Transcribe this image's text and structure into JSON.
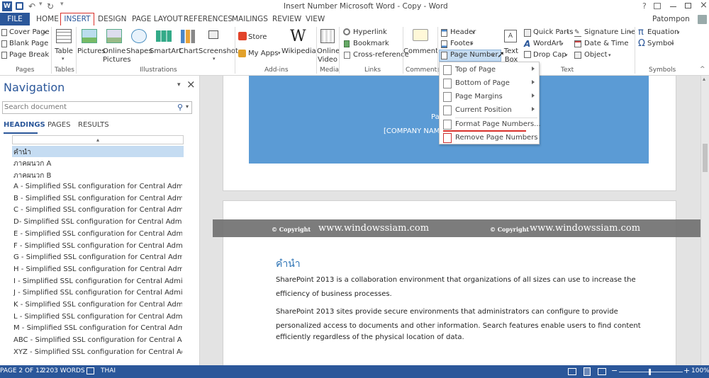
{
  "window": {
    "title": "Insert Number Microsoft Word - Copy - Word",
    "help": "?",
    "user": "Patompon"
  },
  "ribbon": {
    "tabs": [
      "FILE",
      "HOME",
      "INSERT",
      "DESIGN",
      "PAGE LAYOUT",
      "REFERENCES",
      "MAILINGS",
      "REVIEW",
      "VIEW"
    ],
    "active_tab": "INSERT",
    "pages": {
      "items": [
        "Cover Page",
        "Blank Page",
        "Page Break"
      ],
      "label": "Pages"
    },
    "tables": {
      "table": "Table",
      "label": "Tables"
    },
    "illustrations": {
      "pictures": "Pictures",
      "online_pictures": "Online Pictures",
      "shapes": "Shapes",
      "smartart": "SmartArt",
      "chart": "Chart",
      "screenshot": "Screenshot",
      "label": "Illustrations"
    },
    "addins": {
      "store": "Store",
      "my_apps": "My Apps",
      "wikipedia": "Wikipedia",
      "label": "Add-ins"
    },
    "media": {
      "online_video": "Online Video",
      "label": "Media"
    },
    "links": {
      "items": [
        "Hyperlink",
        "Bookmark",
        "Cross-reference"
      ],
      "label": "Links"
    },
    "comments": {
      "comment": "Comment",
      "label": "Comments"
    },
    "header_footer": {
      "header": "Header",
      "footer": "Footer",
      "page_number": "Page Number"
    },
    "text": {
      "text_box": "Text Box",
      "quick_parts": "Quick Parts",
      "wordart": "WordArt",
      "drop_cap": "Drop Cap",
      "signature_line": "Signature Line",
      "date_time": "Date & Time",
      "object": "Object",
      "label": "Text"
    },
    "symbols": {
      "equation": "Equation",
      "symbol": "Symbol",
      "label": "Symbols"
    }
  },
  "page_number_menu": {
    "items": [
      "Top of Page",
      "Bottom of Page",
      "Page Margins",
      "Current Position",
      "Format Page Numbers...",
      "Remove Page Numbers"
    ]
  },
  "navigation": {
    "title": "Navigation",
    "search_placeholder": "Search document",
    "tabs": [
      "HEADINGS",
      "PAGES",
      "RESULTS"
    ],
    "headings": [
      "คำนำ",
      "ภาคผนวก A",
      "ภาคผนวก B",
      "A - Simplified SSL configuration for Central Administrati...",
      "B - Simplified SSL configuration for Central Administrati...",
      "C - Simplified SSL configuration for Central Administrati...",
      "D- Simplified SSL configuration for Central Administrati...",
      "E - Simplified SSL configuration for Central Administrati...",
      "F - Simplified SSL configuration for Central Administrati...",
      "G - Simplified SSL configuration for Central Administrati...",
      "H - Simplified SSL configuration for Central Administrati...",
      "I - Simplified SSL configuration for Central Administrati...",
      "J - Simplified SSL configuration for Central Administrati...",
      "K - Simplified SSL configuration for Central Administrati...",
      "L - Simplified SSL configuration for Central Administrati...",
      "M - Simplified SSL configuration for Central Administrat...",
      "ABC - Simplified SSL configuration for Central Administ...",
      "XYZ - Simplified SSL configuration for Central Administ..."
    ]
  },
  "document": {
    "cover_text_1": "Pa",
    "cover_text_2": "[COMPANY NAM",
    "watermark_copy": "© Copyright",
    "watermark_url": "www.windowssiam.com",
    "heading": "คำนำ",
    "p1_a": "SharePoint 2013 is a collaboration environment that organizations of all sizes can use to increase the",
    "p1_b": "efficiency of business processes.",
    "p2_a": "SharePoint 2013 sites provide secure environments that administrators can configure to provide",
    "p2_b": "personalized access to documents and other information. Search features enable users to find content",
    "p2_c": "efficiently regardless of the physical location of data."
  },
  "status": {
    "page": "PAGE 2 OF 12",
    "words": "2203 WORDS",
    "language": "THAI",
    "zoom": "100%"
  },
  "colors": {
    "word_blue": "#2b579a",
    "cover_blue": "#5b9bd5",
    "highlight_red": "#d9302a"
  }
}
